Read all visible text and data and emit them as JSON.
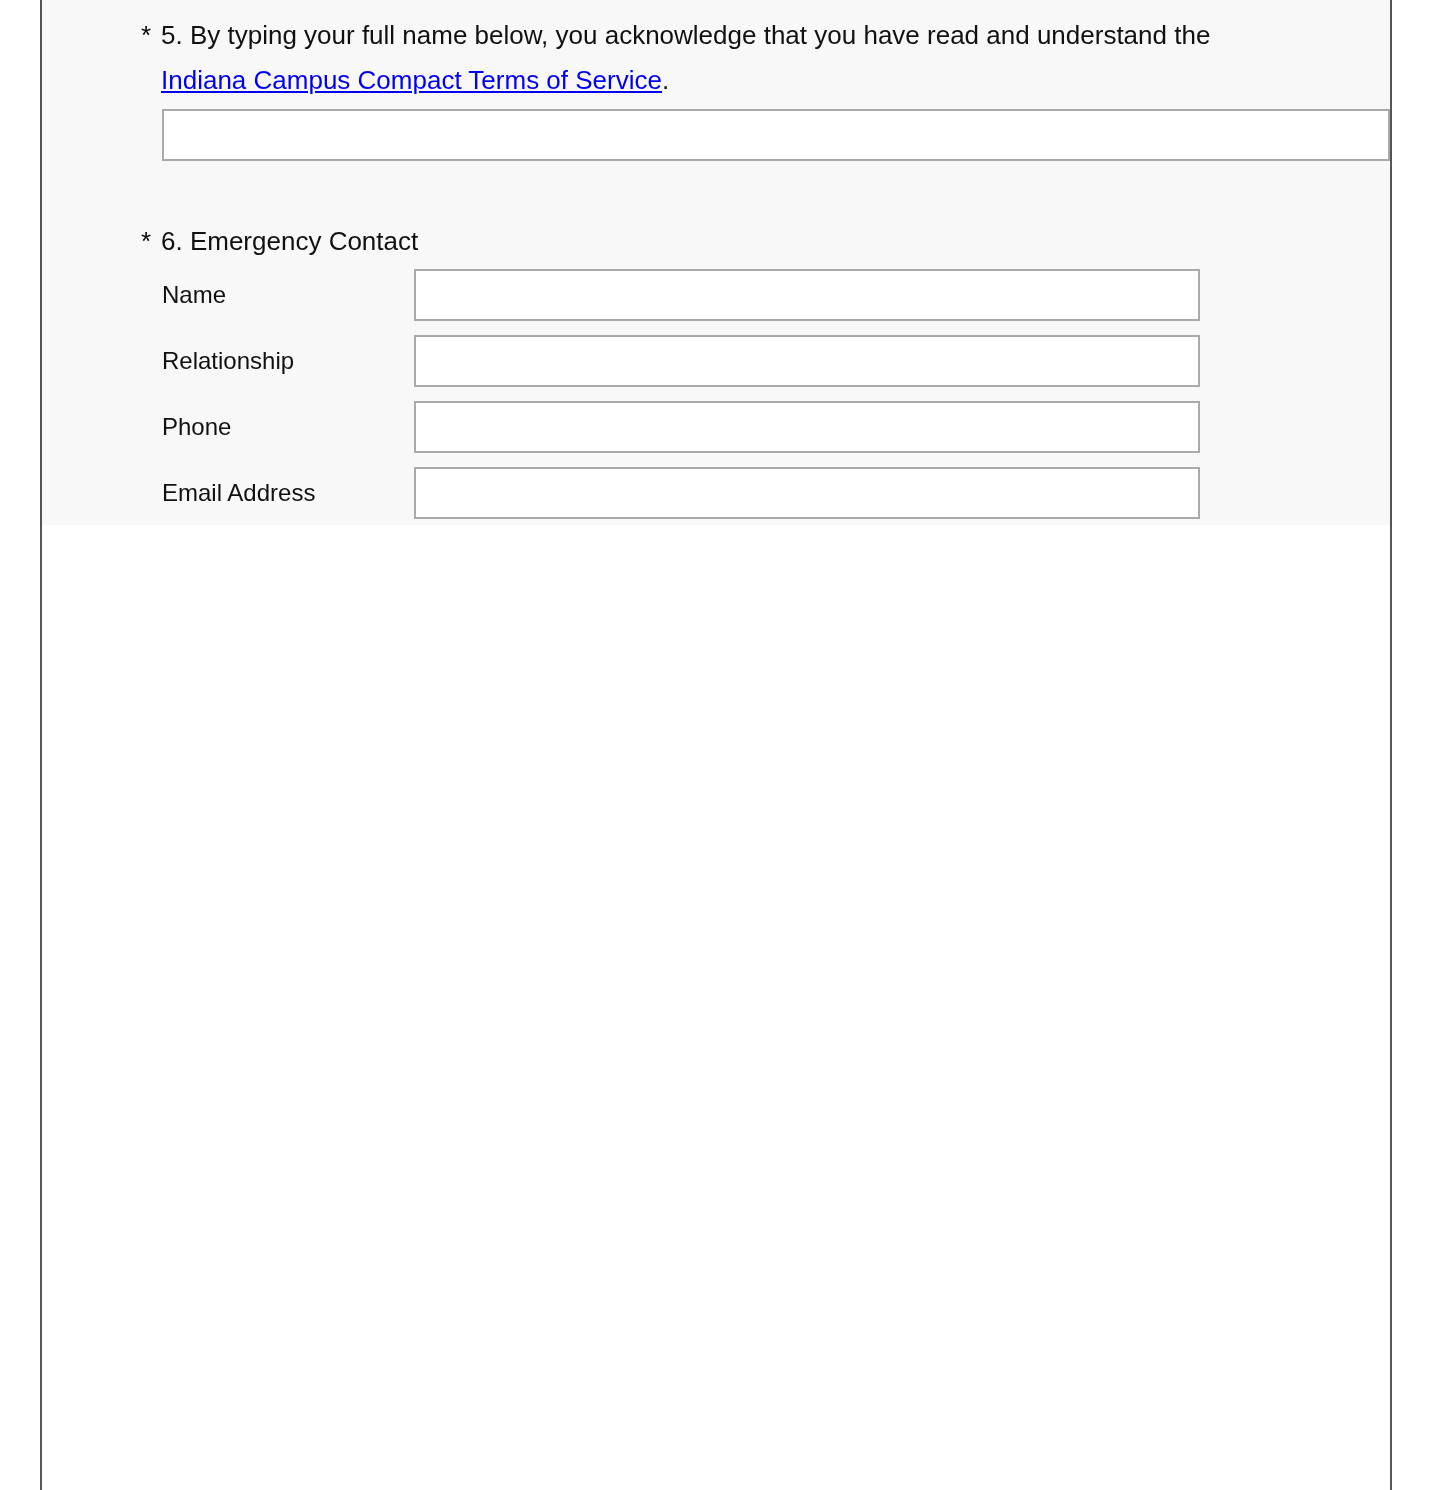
{
  "questions": [
    {
      "kind": "single",
      "required_mark": "*",
      "text": "5. By typing your full name below, you acknowledge that you have read and understand the",
      "link": "Indiana Campus Compact Terms of Service",
      "after_link": "."
    },
    {
      "kind": "multi",
      "required_mark": "*",
      "text": "6. Emergency Contact",
      "fields": [
        {
          "label": "Name"
        },
        {
          "label": "Relationship"
        },
        {
          "label": "Phone"
        },
        {
          "label": "Email Address"
        }
      ]
    }
  ]
}
